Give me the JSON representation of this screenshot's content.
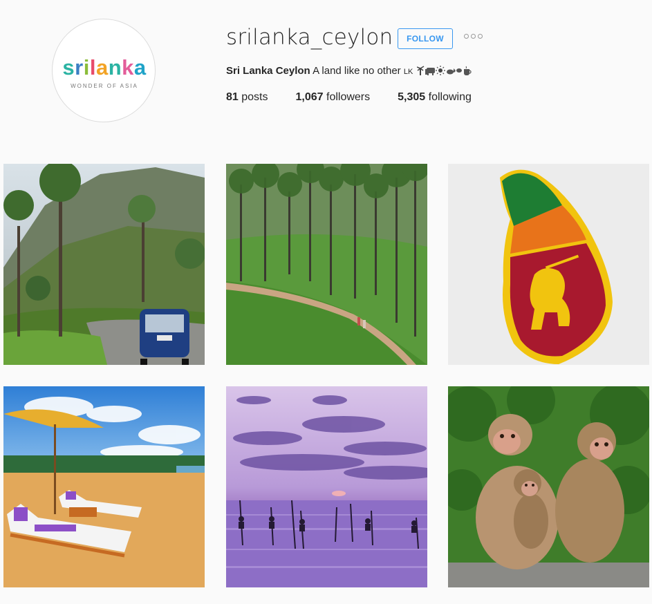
{
  "profile": {
    "username": "srilanka_ceylon",
    "follow_label": "FOLLOW",
    "full_name": "Sri Lanka Ceylon",
    "bio": "A land like no other",
    "bio_flag": "LK",
    "logo_text": "srilanka",
    "logo_tagline": "WONDER OF ASIA"
  },
  "stats": {
    "posts_count": "81",
    "posts_label": "posts",
    "followers_count": "1,067",
    "followers_label": "followers",
    "following_count": "5,305",
    "following_label": "following"
  },
  "posts": [
    {
      "icon": "tuk-tuk-road-photo"
    },
    {
      "icon": "tea-plantation-photo"
    },
    {
      "icon": "sri-lanka-flag-map-photo"
    },
    {
      "icon": "beach-loungers-photo"
    },
    {
      "icon": "stilt-fishermen-sunset-photo"
    },
    {
      "icon": "monkeys-photo"
    }
  ],
  "colors": {
    "accent": "#3897f0",
    "background": "#fafafa",
    "text": "#262626"
  }
}
